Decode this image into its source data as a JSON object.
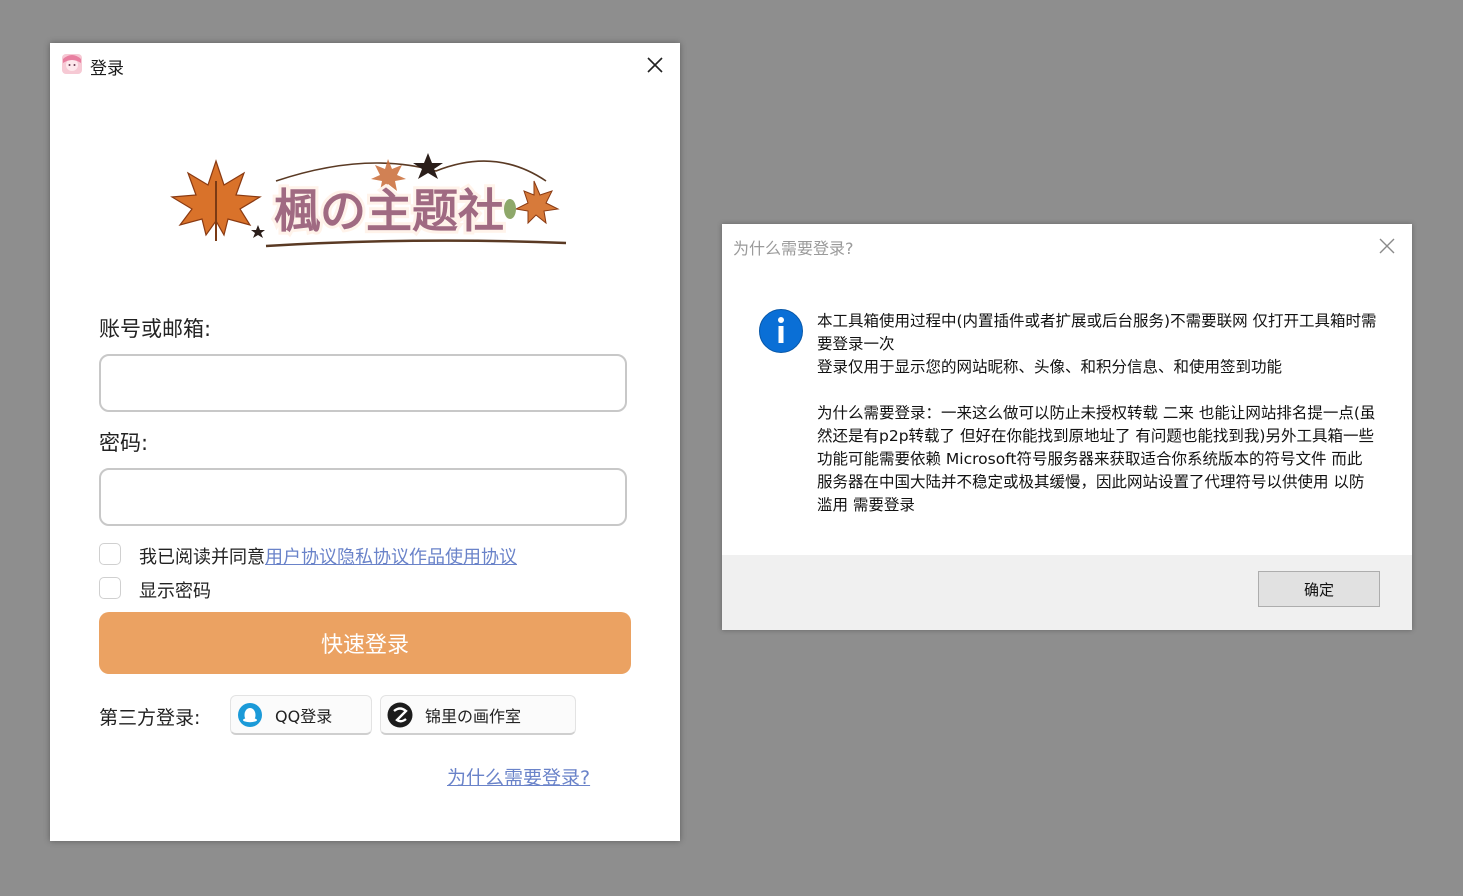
{
  "login": {
    "title": "登录",
    "logo_text": "楓の主题社",
    "account_label": "账号或邮箱:",
    "account_value": "",
    "password_label": "密码:",
    "password_value": "",
    "agree_prefix": "我已阅读并同意",
    "agree_links": [
      "用户协议",
      "隐私协议",
      "作品使用协议"
    ],
    "show_password_label": "显示密码",
    "submit_label": "快速登录",
    "third_party_label": "第三方登录:",
    "qq_label": "QQ登录",
    "studio_label": "锦里の画作室",
    "why_link": "为什么需要登录?",
    "colors": {
      "primary": "#eba262",
      "link": "#6a83c9"
    }
  },
  "dialog": {
    "title": "为什么需要登录?",
    "message_lines": [
      "本工具箱使用过程中(内置插件或者扩展或后台服务)不需要联网 仅打开工具箱时需要登录一次",
      "登录仅用于显示您的网站昵称、头像、和积分信息、和使用签到功能",
      "为什么需要登录：一来这么做可以防止未授权转载 二来 也能让网站排名提一点(虽然还是有p2p转载了 但好在你能找到原地址了 有问题也能找到我)另外工具箱一些功能可能需要依赖 Microsoft符号服务器来获取适合你系统版本的符号文件 而此服务器在中国大陆并不稳定或极其缓慢，因此网站设置了代理符号以供使用 以防滥用 需要登录"
    ],
    "ok_label": "确定",
    "colors": {
      "info": "#0a6fd6"
    }
  }
}
